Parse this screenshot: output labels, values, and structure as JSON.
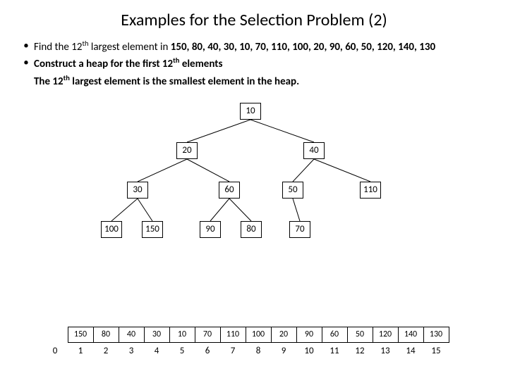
{
  "title": "Examples for the Selection Problem (2)",
  "bullets": {
    "b1_pre": "Find the 12",
    "b1_sup": "th",
    "b1_post": " largest element in ",
    "b1_list": "150, 80, 40, 30, 10, 70, 110, 100, 20, 90, 60, 50, 120, 140, 130",
    "b2_pre": "Construct a heap for the first 12",
    "b2_sup": "th",
    "b2_post": " elements",
    "b3_pre": "The 12",
    "b3_sup": "th",
    "b3_post": " largest element is the smallest element in the heap."
  },
  "nodes": {
    "n1": "10",
    "n2": "20",
    "n3": "40",
    "n4": "30",
    "n5": "60",
    "n6": "50",
    "n7": "110",
    "n8": "100",
    "n9": "150",
    "n10": "90",
    "n11": "80",
    "n12": "70"
  },
  "arr": {
    "c1": "150",
    "c2": "80",
    "c3": "40",
    "c4": "30",
    "c5": "10",
    "c6": "70",
    "c7": "110",
    "c8": "100",
    "c9": "20",
    "c10": "90",
    "c11": "60",
    "c12": "50",
    "c13": "120",
    "c14": "140",
    "c15": "130",
    "i0": "0",
    "i1": "1",
    "i2": "2",
    "i3": "3",
    "i4": "4",
    "i5": "5",
    "i6": "6",
    "i7": "7",
    "i8": "8",
    "i9": "9",
    "i10": "10",
    "i11": "11",
    "i12": "12",
    "i13": "13",
    "i14": "14",
    "i15": "15"
  }
}
